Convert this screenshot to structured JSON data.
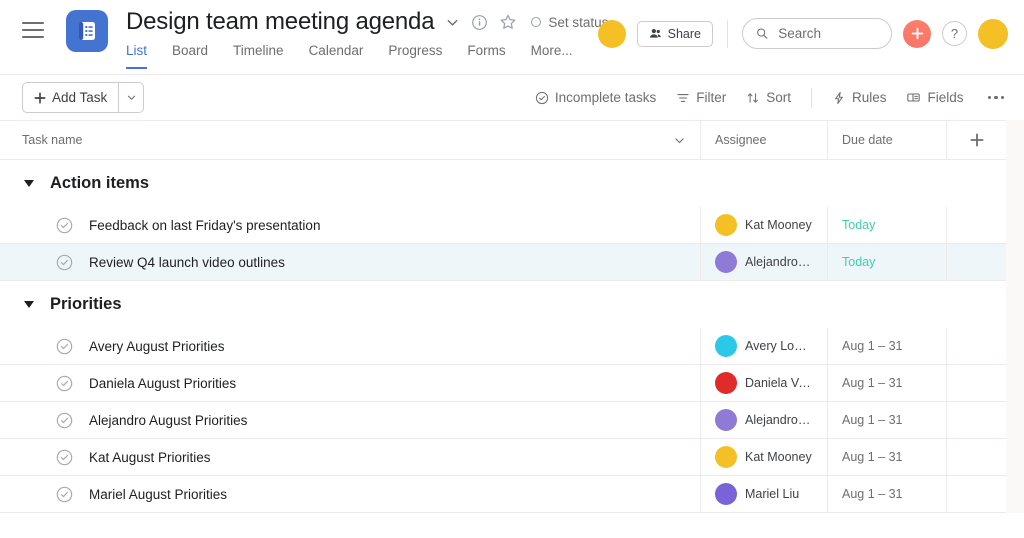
{
  "header": {
    "project_title": "Design team meeting agenda",
    "set_status_label": "Set status",
    "share_label": "Share",
    "help_label": "?",
    "omni_label": "+",
    "tabs": [
      {
        "label": "List",
        "active": true
      },
      {
        "label": "Board",
        "active": false
      },
      {
        "label": "Timeline",
        "active": false
      },
      {
        "label": "Calendar",
        "active": false
      },
      {
        "label": "Progress",
        "active": false
      },
      {
        "label": "Forms",
        "active": false
      },
      {
        "label": "More...",
        "active": false
      }
    ]
  },
  "search": {
    "placeholder": "Search",
    "value": ""
  },
  "toolbar": {
    "add_task_label": "Add Task",
    "incomplete_tasks_label": "Incomplete tasks",
    "filter_label": "Filter",
    "sort_label": "Sort",
    "rules_label": "Rules",
    "fields_label": "Fields"
  },
  "table": {
    "columns": {
      "task_name": "Task name",
      "assignee": "Assignee",
      "due_date": "Due date",
      "add_column": "+"
    },
    "sections": [
      {
        "title": "Action items",
        "collapsed": false,
        "rows": [
          {
            "name": "Feedback on last Friday's presentation",
            "assignee": "Kat Mooney",
            "avatar_color": "#f5c026",
            "due": "Today",
            "due_kind": "today",
            "highlight": false
          },
          {
            "name": "Review Q4 launch video outlines",
            "assignee": "Alejandro Lu...",
            "avatar_color": "#8f7ad6",
            "due": "Today",
            "due_kind": "today",
            "highlight": true
          }
        ]
      },
      {
        "title": "Priorities",
        "collapsed": false,
        "rows": [
          {
            "name": "Avery August Priorities",
            "assignee": "Avery Lomax",
            "avatar_color": "#2bc8e8",
            "due": "Aug 1 – 31",
            "due_kind": "range",
            "highlight": false
          },
          {
            "name": "Daniela August Priorities",
            "assignee": "Daniela Varg...",
            "avatar_color": "#e02b2b",
            "due": "Aug 1 – 31",
            "due_kind": "range",
            "highlight": false
          },
          {
            "name": "Alejandro August Priorities",
            "assignee": "Alejandro Lu...",
            "avatar_color": "#8f7ad6",
            "due": "Aug 1 – 31",
            "due_kind": "range",
            "highlight": false
          },
          {
            "name": "Kat August Priorities",
            "assignee": "Kat Mooney",
            "avatar_color": "#f5c026",
            "due": "Aug 1 – 31",
            "due_kind": "range",
            "highlight": false
          },
          {
            "name": "Mariel August Priorities",
            "assignee": "Mariel Liu",
            "avatar_color": "#7a63d8",
            "due": "Aug 1 – 31",
            "due_kind": "range",
            "highlight": false
          }
        ]
      }
    ]
  },
  "colors": {
    "brand_blue": "#4573d2",
    "today_green": "#3ecfaa",
    "omni_coral": "#f8766a",
    "row_highlight": "#eff6fa",
    "border": "#edeae9"
  },
  "icons": {
    "hamburger": "hamburger-icon",
    "project_logo": "project-list-logo-icon",
    "chevron_down": "chevron-down-icon",
    "info": "info-icon",
    "star": "star-icon",
    "search": "search-icon",
    "people": "people-icon",
    "plus": "plus-icon",
    "filter": "filter-icon",
    "sort": "sort-icon",
    "rules": "lightning-icon",
    "fields": "fields-icon",
    "more": "more-horizontal-icon",
    "check_circle": "check-circle-icon"
  }
}
